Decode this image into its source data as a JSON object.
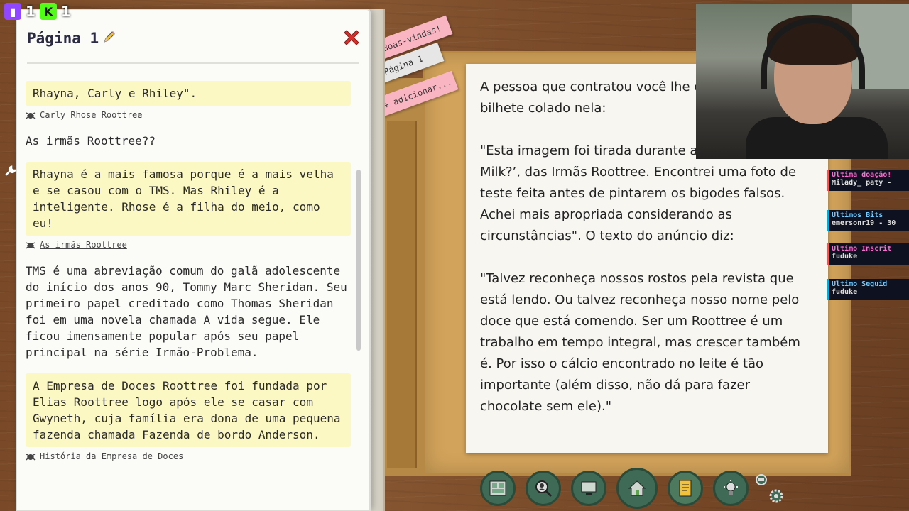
{
  "overlay": {
    "twitch_count": "1",
    "kick_letter": "K",
    "kick_count": "1"
  },
  "journal": {
    "title": "Página 1",
    "entries": [
      {
        "kind": "note",
        "text": "Rhayna, Carly e Rhiley\"."
      },
      {
        "kind": "source",
        "text": "Carly Rhose Roottree"
      },
      {
        "kind": "plain",
        "text": "As irmãs Roottree??"
      },
      {
        "kind": "note",
        "text": "Rhayna é a mais famosa porque é a mais velha e se casou com o TMS. Mas Rhiley é a inteligente. Rhose é a filha do meio, como eu!"
      },
      {
        "kind": "source",
        "text": "As irmãs Roottree"
      },
      {
        "kind": "plain",
        "text": "TMS é uma abreviação comum do galã adolescente do início dos anos 90, Tommy Marc Sheridan. Seu primeiro papel creditado como Thomas Sheridan foi em uma novela chamada A vida segue. Ele ficou imensamente popular após seu papel principal na série Irmão-Problema."
      },
      {
        "kind": "note",
        "text": "A Empresa de Doces Roottree foi fundada por Elias Roottree logo após ele se casar com Gwyneth, cuja família era dona de uma pequena fazenda chamada Fazenda de bordo Anderson."
      },
      {
        "kind": "source",
        "text": "História da Empresa de Doces"
      }
    ]
  },
  "tabs": {
    "welcome": "Boas-vindas!",
    "page": "Página 1",
    "add": "+ adicionar..."
  },
  "document": {
    "paragraphs": [
      "A pessoa que contratou você lhe e foto com um bilhete colado nela:",
      "\"Esta imagem foi tirada durante a do anúncio ‘Got Milk?’, das Irmãs Roottree. Encontrei uma foto de teste feita antes de pintarem os bigodes falsos. Achei mais apropriada considerando as circunstâncias\". O texto do anúncio diz:",
      "\"Talvez reconheça nossos rostos pela revista que está lendo. Ou talvez reconheça nosso nome pelo doce que está comendo. Ser um Roottree é um trabalho em tempo integral, mas crescer também é. Por isso o cálcio encontrado no leite é tão importante (além disso, não dá para fazer chocolate sem ele).\""
    ]
  },
  "widgets": {
    "last_donation_label": "Ultima doação!",
    "last_donation_value": "Milady_ paty -",
    "last_bits_label": "Ultimos Bits",
    "last_bits_value": "emersonr19 - 30",
    "last_sub_label": "Ultimo Inscrit",
    "last_sub_value": "fuduke",
    "last_follow_label": "Ultimo Seguid",
    "last_follow_value": "fuduke"
  },
  "colors": {
    "note_yellow": "#fcf8c4",
    "tab_pink": "#f9b6c2",
    "close_red": "#d9302c",
    "toolbar_green": "#3f6a55"
  },
  "icons": [
    "twitch-icon",
    "kick-icon",
    "pencil-icon",
    "close-icon",
    "wrench-icon",
    "bug-icon",
    "photo-board-icon",
    "search-person-icon",
    "computer-icon",
    "home-icon",
    "notebook-icon",
    "lightbulb-icon",
    "magnifier-icon",
    "settings-icon"
  ]
}
